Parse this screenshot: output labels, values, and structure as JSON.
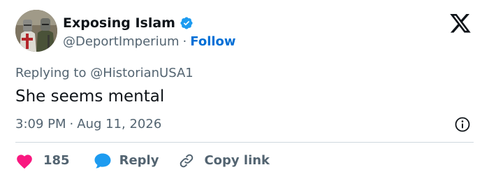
{
  "author": {
    "display_name": "Exposing Islam",
    "handle": "@DeportImperium",
    "separator": "·",
    "follow_label": "Follow"
  },
  "tweet": {
    "reply_prefix": "Replying to",
    "reply_mention": "@HistorianUSA1",
    "text": "She seems mental",
    "time": "3:09 PM",
    "separator": "·",
    "date": "Aug 11, 2026"
  },
  "actions": {
    "like_count": "185",
    "reply_label": "Reply",
    "copy_link_label": "Copy link"
  },
  "icons": {
    "avatar": "avatar-knights",
    "verified": "verified-badge-icon",
    "logo": "x-logo-icon",
    "info": "info-icon",
    "like": "heart-icon",
    "reply": "speech-bubble-icon",
    "copy_link": "link-icon"
  },
  "colors": {
    "text": "#0f1419",
    "secondary": "#536471",
    "follow": "#006fd6",
    "verified": "#1d9bf0",
    "heart": "#f91880",
    "reply_icon": "#1d9bf0",
    "divider": "#cfd9de"
  }
}
